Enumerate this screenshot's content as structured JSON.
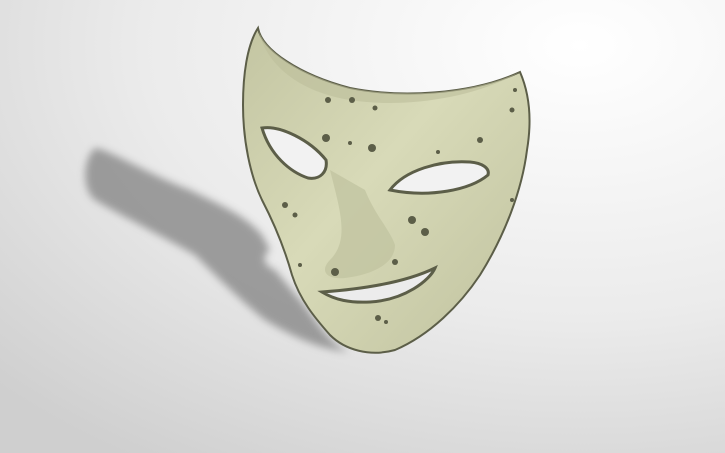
{
  "scene": {
    "subject": "mask-3d-model",
    "colors": {
      "mask": "#d3d5b2",
      "mask_shade": "#a9ab88",
      "mask_outline": "#5c5e48",
      "shadow": "#8c8c8c",
      "background_light": "#ffffff",
      "background_dark": "#d2d2d2"
    }
  }
}
